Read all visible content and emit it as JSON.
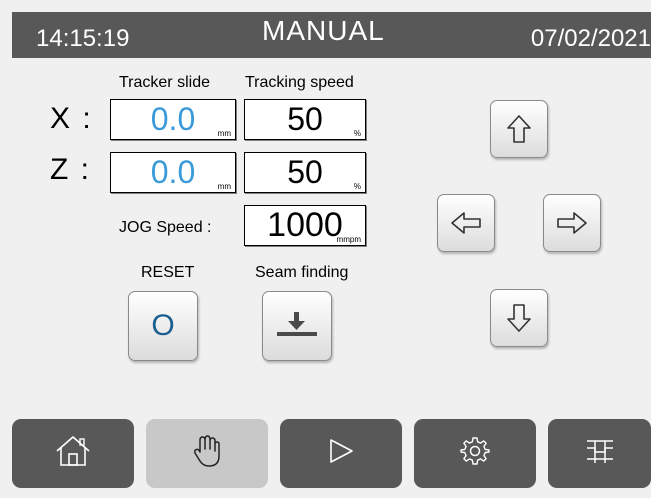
{
  "header": {
    "time": "14:15:19",
    "title": "MANUAL",
    "date": "07/02/2021"
  },
  "columns": {
    "tracker_slide": "Tracker slide",
    "tracking_speed": "Tracking speed"
  },
  "axes": [
    {
      "label": "X :",
      "slide_value": "0.0",
      "slide_unit": "mm",
      "speed_value": "50",
      "speed_unit": "%"
    },
    {
      "label": "Z :",
      "slide_value": "0.0",
      "slide_unit": "mm",
      "speed_value": "50",
      "speed_unit": "%"
    }
  ],
  "jog": {
    "label": "JOG Speed :",
    "value": "1000",
    "unit": "mmpm"
  },
  "actions": {
    "reset_label": "RESET",
    "reset_glyph": "O",
    "seam_label": "Seam finding"
  },
  "icons": {
    "up": "arrow-up-icon",
    "down": "arrow-down-icon",
    "left": "arrow-left-icon",
    "right": "arrow-right-icon",
    "seam": "seam-finding-icon",
    "home": "home-icon",
    "hand": "hand-icon",
    "play": "play-icon",
    "gear": "gear-icon",
    "lines": "parameters-icon"
  },
  "colors": {
    "header_bg": "#585858",
    "nav_bg": "#585858",
    "nav_active_bg": "#c8c8c8",
    "value_blue": "#3b9ad9",
    "reset_glyph": "#1a5f8f"
  },
  "nav": {
    "active": "manual"
  }
}
